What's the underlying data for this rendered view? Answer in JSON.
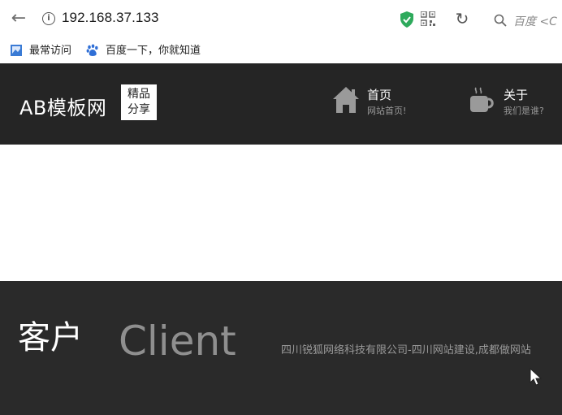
{
  "browser": {
    "url": "192.168.37.133",
    "search_placeholder": "百度 <C",
    "icons": {
      "back": "arrow-left-icon",
      "info": "info-icon",
      "shield": "shield-check-icon",
      "qr": "qr-code-icon",
      "refresh": "refresh-icon",
      "search": "search-icon"
    }
  },
  "bookmarks": [
    {
      "label": "最常访问",
      "icon": "bookmark-page-icon"
    },
    {
      "label": "百度一下，你就知道",
      "icon": "baidu-paw-icon"
    }
  ],
  "site": {
    "logo_text": "AB模板网",
    "logo_badge_line1": "精品",
    "logo_badge_line2": "分享",
    "nav": [
      {
        "label": "首页",
        "sub": "网站首页!",
        "icon": "home-icon"
      },
      {
        "label": "关于",
        "sub": "我们是谁?",
        "icon": "coffee-cup-icon"
      }
    ]
  },
  "client": {
    "title_cn": "客户",
    "title_en": "Client",
    "description": "四川锐狐网络科技有限公司-四川网站建设,成都做网站"
  },
  "colors": {
    "header_bg": "#252525",
    "section_bg": "#2a2a2a",
    "shield_green": "#2eaa5c"
  }
}
